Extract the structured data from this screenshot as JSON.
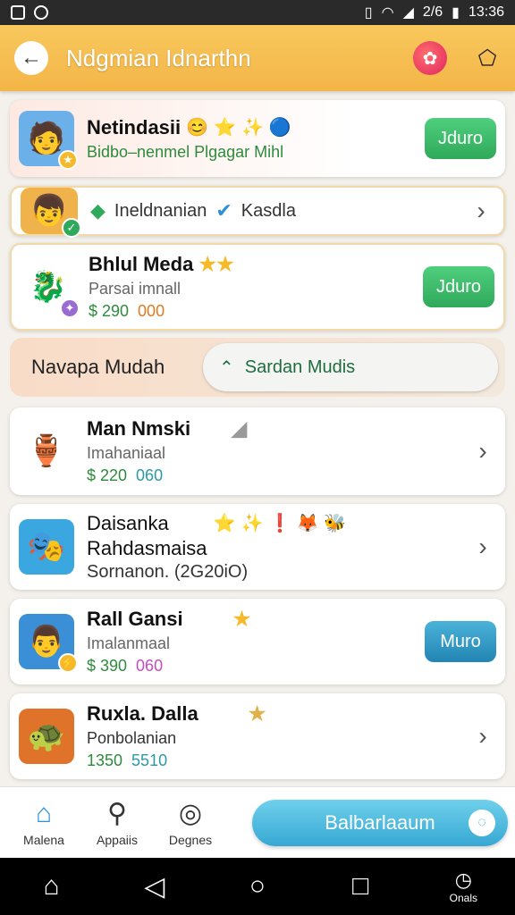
{
  "status_bar": {
    "signal": "2/6",
    "time": "13:36"
  },
  "app_bar": {
    "title": "Ndgmian Idnarthn"
  },
  "cards": [
    {
      "title": "Netindasii",
      "subtitle": "Bidbo–nenmel Plgagar Mihl",
      "action": "Jduro",
      "emojis": [
        "😊",
        "⭐",
        "✨",
        "🔵"
      ],
      "thumb": "🧑",
      "thumb_bg": "#6bb0e8"
    },
    {
      "title": "Ineldnanian",
      "subtitle": "Kasdla",
      "thumb": "👦",
      "thumb_bg": "#f0b24a"
    },
    {
      "title": "Bhlul Meda",
      "subtitle": "Parsai imnall",
      "price": "$ 290",
      "price_alt": "000",
      "action": "Jduro",
      "thumb": "🐉",
      "thumb_bg": "#ffffff"
    },
    {
      "title": "Man Nmski",
      "subtitle": "Imahaniaal",
      "price": "$ 220",
      "price_alt": "060",
      "thumb": "🏺",
      "thumb_bg": "#ffffff"
    },
    {
      "title": "Daisanka",
      "title2": "Rahdasmaisa",
      "subtitle": "Sornanon. (2G20iO)",
      "emojis": [
        "⭐",
        "✨",
        "❗",
        "🦊",
        "🐝"
      ],
      "thumb": "🎭",
      "thumb_bg": "#3ba7e0"
    },
    {
      "title": "Rall Gansi",
      "subtitle": "Imalanmaal",
      "price": "$ 390",
      "price_alt": "060",
      "action": "Muro",
      "thumb": "👨",
      "thumb_bg": "#3a8fd6"
    },
    {
      "title": "Ruxla. Dalla",
      "subtitle": "Ponbolanian",
      "price": "1350",
      "price_alt": "5510",
      "thumb": "🐢",
      "thumb_bg": "#e0732a"
    }
  ],
  "filter": {
    "label": "Navapa Mudah",
    "pill": "Sardan Mudis"
  },
  "bottom_nav": {
    "items": [
      {
        "label": "Malena"
      },
      {
        "label": "Appaiis"
      },
      {
        "label": "Degnes"
      }
    ],
    "cta": "Balbarlaaum"
  },
  "system_nav": {
    "label": "Onals"
  }
}
